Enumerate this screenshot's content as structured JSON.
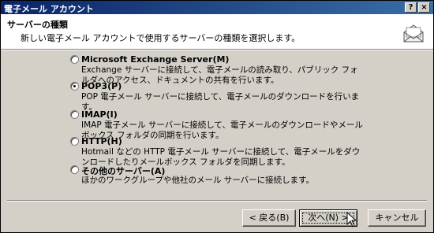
{
  "window": {
    "title": "電子メール アカウント",
    "help": "?",
    "close": "×"
  },
  "header": {
    "title": "サーバーの種類",
    "description": "新しい電子メール アカウントで使用するサーバーの種類を選択します。",
    "icon": "envelope-icon"
  },
  "options": [
    {
      "label": "Microsoft Exchange Server(M)",
      "description": "Exchange サーバーに接続して、電子メールの読み取り、パブリック フォルダへのアクセス、ドキュメントの共有を行います。",
      "checked": false
    },
    {
      "label": "POP3(P)",
      "description": "POP 電子メール サーバーに接続して、電子メールのダウンロードを行います。",
      "checked": true
    },
    {
      "label": "IMAP(I)",
      "description": "IMAP 電子メール サーバーに接続して、電子メールのダウンロードやメールボックス フォルダの同期を行います。",
      "checked": false
    },
    {
      "label": "HTTP(H)",
      "description": "Hotmail などの HTTP 電子メール サーバーに接続して、電子メールをダウンロードしたりメールボックス フォルダを同期します。",
      "checked": false
    },
    {
      "label": "その他のサーバー(A)",
      "description": "ほかのワークグループや他社のメール サーバーに接続します。",
      "checked": false
    }
  ],
  "buttons": {
    "back": "< 戻る(B)",
    "next": "次へ(N) >",
    "cancel": "キャンセル"
  }
}
